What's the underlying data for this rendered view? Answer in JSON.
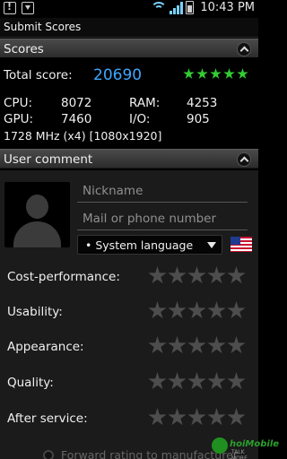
{
  "status_bar": {
    "time": "10:43 PM",
    "icons": [
      "warning-icon",
      "download-icon",
      "wifi-icon",
      "signal-icon",
      "battery-icon"
    ]
  },
  "title": "Submit Scores",
  "scores": {
    "section_label": "Scores",
    "total_label": "Total score:",
    "total_value": "20690",
    "star_rating": 5,
    "star_color": "#33cc33",
    "cpu_label": "CPU:",
    "cpu_value": "8072",
    "ram_label": "RAM:",
    "ram_value": "4253",
    "gpu_label": "GPU:",
    "gpu_value": "7460",
    "io_label": "I/O:",
    "io_value": "905",
    "device_info": "1728 MHz (x4) [1080x1920]"
  },
  "comment": {
    "section_label": "User comment",
    "nickname_placeholder": "Nickname",
    "contact_placeholder": "Mail or phone number",
    "language_value": "• System language",
    "flag": "us-flag-icon",
    "ratings": [
      {
        "label": "Cost-performance:",
        "value": 0
      },
      {
        "label": "Usability:",
        "value": 0
      },
      {
        "label": "Appearance:",
        "value": 0
      },
      {
        "label": "Quality:",
        "value": 0
      },
      {
        "label": "After service:",
        "value": 0
      }
    ],
    "forward_label": "Forward rating to manufacturer"
  },
  "watermark": {
    "line1": "hoiMobile",
    "line2": "TALK MORE"
  }
}
